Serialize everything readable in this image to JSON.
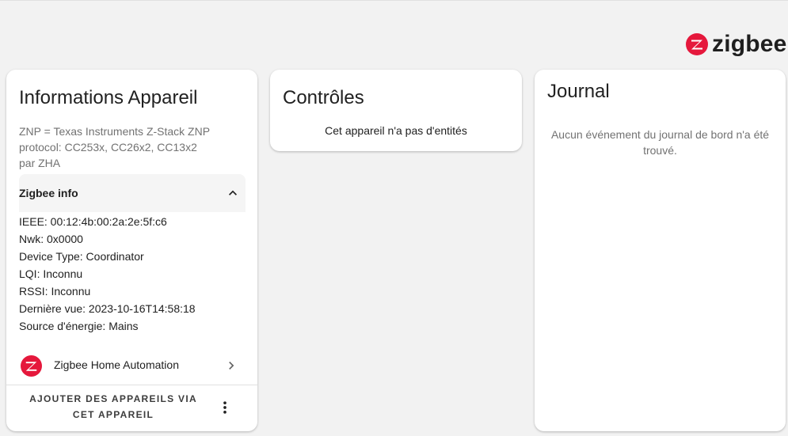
{
  "brand": {
    "name": "zigbee",
    "logo_icon": "zigbee-logo-icon",
    "logo_color": "#e5183c"
  },
  "info_card": {
    "title": "Informations Appareil",
    "description_lines": [
      "ZNP = Texas Instruments Z-Stack ZNP",
      "protocol: CC253x, CC26x2, CC13x2",
      "par ZHA"
    ],
    "expander": {
      "label": "Zigbee info",
      "expanded": true,
      "icon": "chevron-up-icon"
    },
    "zigbee_info": [
      "IEEE: 00:12:4b:00:2a:2e:5f:c6",
      "Nwk: 0x0000",
      "Device Type: Coordinator",
      "LQI: Inconnu",
      "RSSI: Inconnu",
      "Dernière vue: 2023-10-16T14:58:18",
      "Source d'énergie: Mains"
    ],
    "integration": {
      "label": "Zigbee Home Automation",
      "icon": "zigbee-logo-icon",
      "arrow_icon": "chevron-right-icon"
    },
    "actions": {
      "add_devices_line1": "AJOUTER DES APPAREILS VIA",
      "add_devices_line2": "CET APPAREIL",
      "more_icon": "more-vertical-icon"
    }
  },
  "controls_card": {
    "title": "Contrôles",
    "empty_text": "Cet appareil n'a pas d'entités"
  },
  "journal_card": {
    "title": "Journal",
    "empty_text": "Aucun événement du journal de bord n'a été trouvé."
  }
}
